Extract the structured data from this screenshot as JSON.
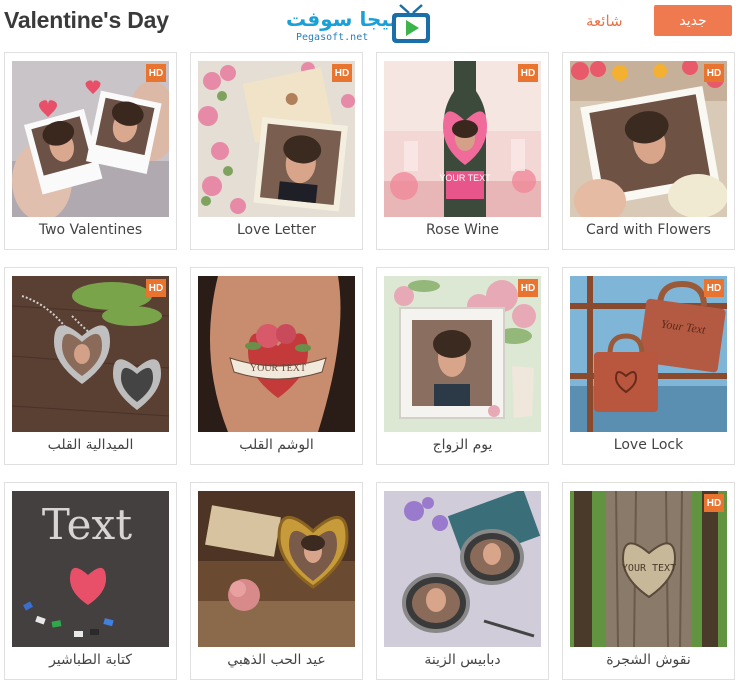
{
  "header": {
    "title": "Valentine's Day",
    "logo_arabic": "بيجا سوفت",
    "logo_english": "Pegasoft.net",
    "tab_popular": "شائعة",
    "button_new": "جديد"
  },
  "colors": {
    "accent": "#f07a4f",
    "hd_badge": "#e8742f",
    "card_border": "#e0e0e0",
    "logo_blue": "#1aa0d8"
  },
  "cards": [
    {
      "label": "Two Valentines",
      "hd": "HD",
      "icon": "two-valentines-thumbnail"
    },
    {
      "label": "Love Letter",
      "hd": "HD",
      "icon": "love-letter-thumbnail"
    },
    {
      "label": "Rose Wine",
      "hd": "HD",
      "icon": "rose-wine-thumbnail"
    },
    {
      "label": "Card with Flowers",
      "hd": "HD",
      "icon": "card-with-flowers-thumbnail"
    },
    {
      "label": "الميدالية القلب",
      "hd": "HD",
      "icon": "heart-locket-thumbnail"
    },
    {
      "label": "الوشم القلب",
      "hd": "",
      "icon": "heart-tattoo-thumbnail",
      "tattoo_text": "YOUR TEXT"
    },
    {
      "label": "يوم الزواج",
      "hd": "HD",
      "icon": "wedding-day-thumbnail"
    },
    {
      "label": "Love Lock",
      "hd": "HD",
      "icon": "love-lock-thumbnail",
      "lock_text": "Your Text"
    },
    {
      "label": "كتابة الطباشير",
      "hd": "",
      "icon": "chalk-writing-thumbnail",
      "chalk_text": "Text"
    },
    {
      "label": "عيد الحب الذهبي",
      "hd": "",
      "icon": "golden-valentine-thumbnail"
    },
    {
      "label": "دبابيس الزينة",
      "hd": "",
      "icon": "decorative-pins-thumbnail"
    },
    {
      "label": "نقوش الشجرة",
      "hd": "HD",
      "icon": "tree-carving-thumbnail",
      "carving_text": "YOUR TEXT"
    }
  ],
  "rose_wine_text": "YOUR TEXT"
}
